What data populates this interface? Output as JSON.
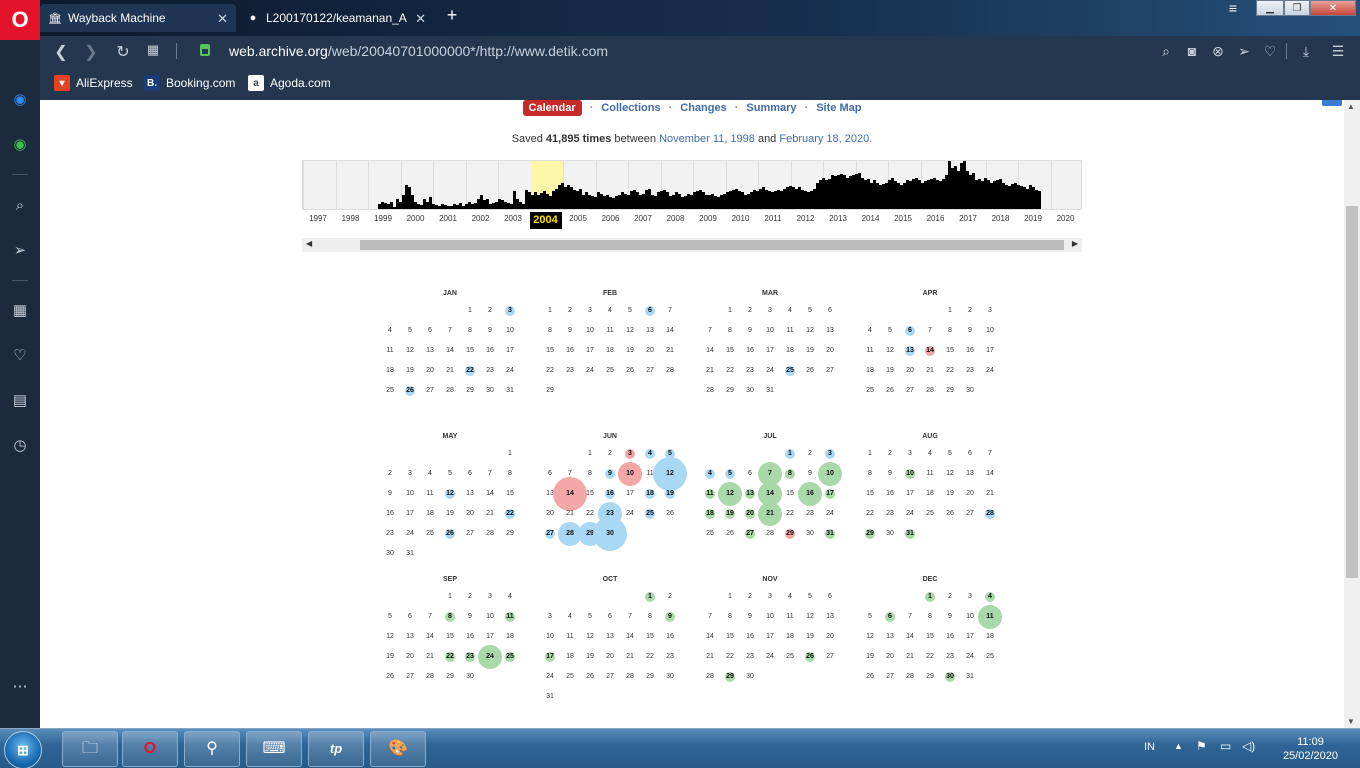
{
  "browser": {
    "tabs": [
      {
        "title": "Wayback Machine"
      },
      {
        "title": "L200170122/keamanan_A"
      }
    ],
    "url_host": "web.archive.org",
    "url_path": "/web/20040701000000*/http://www.detik.com",
    "bookmarks": [
      {
        "label": "AliExpress"
      },
      {
        "label": "Booking.com"
      },
      {
        "label": "Agoda.com"
      }
    ]
  },
  "wayback": {
    "nav": [
      "Calendar",
      "Collections",
      "Changes",
      "Summary",
      "Site Map"
    ],
    "saved_prefix": "Saved ",
    "saved_count": "41,895 times",
    "saved_between": " between ",
    "first_date": "November 11, 1998",
    "and": " and ",
    "last_date": "February 18, 2020.",
    "years": [
      "1997",
      "1998",
      "1999",
      "2000",
      "2001",
      "2002",
      "2003",
      "2004",
      "2005",
      "2006",
      "2007",
      "2008",
      "2009",
      "2010",
      "2011",
      "2012",
      "2013",
      "2014",
      "2015",
      "2016",
      "2017",
      "2018",
      "2019",
      "2020"
    ],
    "selected_year": "2004",
    "histogram": [
      0,
      0,
      0,
      0,
      0,
      0,
      0,
      0,
      0,
      0,
      0,
      0,
      0,
      0,
      0,
      0,
      0,
      0,
      0,
      0,
      0,
      0,
      0,
      0,
      0.1,
      0.15,
      0.12,
      0.1,
      0.14,
      0.05,
      0.2,
      0.15,
      0.3,
      0.5,
      0.45,
      0.3,
      0.15,
      0.1,
      0.08,
      0.2,
      0.15,
      0.25,
      0.1,
      0.08,
      0.07,
      0.1,
      0.08,
      0.07,
      0.06,
      0.1,
      0.08,
      0.12,
      0.06,
      0.1,
      0.14,
      0.1,
      0.12,
      0.2,
      0.3,
      0.18,
      0.2,
      0.1,
      0.12,
      0.15,
      0.2,
      0.18,
      0.15,
      0.12,
      0.1,
      0.38,
      0.2,
      0.15,
      0.1,
      0.4,
      0.35,
      0.3,
      0.36,
      0.3,
      0.34,
      0.38,
      0.32,
      0.28,
      0.38,
      0.42,
      0.5,
      0.55,
      0.45,
      0.5,
      0.45,
      0.4,
      0.38,
      0.42,
      0.3,
      0.35,
      0.3,
      0.28,
      0.25,
      0.35,
      0.32,
      0.28,
      0.3,
      0.25,
      0.22,
      0.28,
      0.3,
      0.35,
      0.32,
      0.3,
      0.38,
      0.4,
      0.35,
      0.3,
      0.32,
      0.4,
      0.42,
      0.3,
      0.28,
      0.35,
      0.38,
      0.4,
      0.35,
      0.28,
      0.3,
      0.35,
      0.32,
      0.25,
      0.28,
      0.32,
      0.3,
      0.35,
      0.38,
      0.4,
      0.35,
      0.3,
      0.3,
      0.32,
      0.28,
      0.25,
      0.3,
      0.32,
      0.35,
      0.38,
      0.4,
      0.42,
      0.38,
      0.35,
      0.3,
      0.32,
      0.35,
      0.4,
      0.38,
      0.42,
      0.45,
      0.4,
      0.38,
      0.35,
      0.38,
      0.4,
      0.38,
      0.42,
      0.45,
      0.48,
      0.45,
      0.42,
      0.45,
      0.4,
      0.38,
      0.35,
      0.38,
      0.42,
      0.55,
      0.6,
      0.65,
      0.6,
      0.62,
      0.7,
      0.68,
      0.7,
      0.72,
      0.7,
      0.65,
      0.68,
      0.7,
      0.72,
      0.75,
      0.65,
      0.6,
      0.62,
      0.55,
      0.6,
      0.55,
      0.5,
      0.52,
      0.55,
      0.6,
      0.65,
      0.58,
      0.55,
      0.5,
      0.55,
      0.6,
      0.58,
      0.62,
      0.65,
      0.6,
      0.55,
      0.58,
      0.6,
      0.62,
      0.65,
      0.6,
      0.58,
      0.62,
      0.7,
      1.0,
      0.85,
      0.9,
      0.8,
      0.95,
      1.0,
      0.8,
      0.7,
      0.75,
      0.6,
      0.62,
      0.58,
      0.65,
      0.6,
      0.55,
      0.58,
      0.6,
      0.62,
      0.55,
      0.5,
      0.48,
      0.52,
      0.55,
      0.5,
      0.48,
      0.45,
      0.42,
      0.5,
      0.45,
      0.4,
      0.38
    ],
    "months": [
      {
        "name": "JAN",
        "start": 4,
        "days": 31,
        "caps": {
          "3": [
            "b",
            1
          ],
          "22": [
            "b",
            1
          ],
          "26": [
            "b",
            1
          ]
        }
      },
      {
        "name": "FEB",
        "start": 0,
        "days": 29,
        "caps": {
          "6": [
            "b",
            1
          ]
        }
      },
      {
        "name": "MAR",
        "start": 1,
        "days": 31,
        "caps": {
          "25": [
            "b",
            1
          ]
        }
      },
      {
        "name": "APR",
        "start": 4,
        "days": 30,
        "caps": {
          "6": [
            "b",
            1
          ],
          "13": [
            "b",
            1
          ],
          "14": [
            "r",
            1
          ]
        }
      },
      {
        "name": "MAY",
        "start": 6,
        "days": 31,
        "caps": {
          "12": [
            "b",
            1
          ],
          "22": [
            "b",
            1
          ],
          "26": [
            "b",
            1
          ]
        }
      },
      {
        "name": "JUN",
        "start": 2,
        "days": 30,
        "caps": {
          "3": [
            "r",
            1
          ],
          "4": [
            "b",
            1
          ],
          "5": [
            "b",
            1
          ],
          "9": [
            "b",
            1
          ],
          "10": [
            "r",
            2
          ],
          "12": [
            "b",
            3
          ],
          "14": [
            "r",
            3
          ],
          "16": [
            "b",
            1
          ],
          "18": [
            "b",
            1
          ],
          "19": [
            "b",
            1
          ],
          "23": [
            "b",
            2
          ],
          "25": [
            "b",
            1
          ],
          "27": [
            "b",
            1
          ],
          "28": [
            "b",
            2
          ],
          "29": [
            "b",
            2
          ],
          "30": [
            "b",
            3
          ]
        }
      },
      {
        "name": "JUL",
        "start": 4,
        "days": 31,
        "caps": {
          "1": [
            "b",
            1
          ],
          "3": [
            "b",
            1
          ],
          "4": [
            "b",
            1
          ],
          "5": [
            "b",
            1
          ],
          "7": [
            "g",
            2
          ],
          "8": [
            "g",
            1
          ],
          "10": [
            "g",
            2
          ],
          "11": [
            "g",
            1
          ],
          "12": [
            "g",
            2
          ],
          "13": [
            "g",
            1
          ],
          "14": [
            "g",
            2
          ],
          "16": [
            "g",
            2
          ],
          "17": [
            "g",
            1
          ],
          "18": [
            "g",
            1
          ],
          "19": [
            "g",
            1
          ],
          "20": [
            "g",
            1
          ],
          "21": [
            "g",
            2
          ],
          "27": [
            "g",
            1
          ],
          "29": [
            "r",
            1
          ],
          "31": [
            "g",
            1
          ]
        }
      },
      {
        "name": "AUG",
        "start": 0,
        "days": 31,
        "caps": {
          "10": [
            "g",
            1
          ],
          "28": [
            "b",
            1
          ],
          "29": [
            "g",
            1
          ],
          "31": [
            "g",
            1
          ]
        }
      },
      {
        "name": "SEP",
        "start": 3,
        "days": 30,
        "caps": {
          "8": [
            "g",
            1
          ],
          "11": [
            "g",
            1
          ],
          "22": [
            "g",
            1
          ],
          "23": [
            "g",
            1
          ],
          "24": [
            "g",
            2
          ],
          "25": [
            "g",
            1
          ]
        }
      },
      {
        "name": "OCT",
        "start": 5,
        "days": 31,
        "caps": {
          "1": [
            "g",
            1
          ],
          "9": [
            "g",
            1
          ],
          "17": [
            "g",
            1
          ]
        }
      },
      {
        "name": "NOV",
        "start": 1,
        "days": 30,
        "caps": {
          "26": [
            "g",
            1
          ],
          "29": [
            "g",
            1
          ]
        }
      },
      {
        "name": "DEC",
        "start": 3,
        "days": 31,
        "caps": {
          "1": [
            "g",
            1
          ],
          "4": [
            "g",
            1
          ],
          "6": [
            "g",
            1
          ],
          "11": [
            "g",
            2
          ],
          "30": [
            "g",
            1
          ]
        }
      }
    ]
  },
  "taskbar": {
    "lang": "IN",
    "time": "11:09",
    "date": "25/02/2020"
  },
  "colors": {
    "blue_bubble": "#a9d8f5",
    "red_bubble": "#f3a7a7",
    "green_bubble": "#a9d8a9",
    "accent": "#416ca8"
  }
}
